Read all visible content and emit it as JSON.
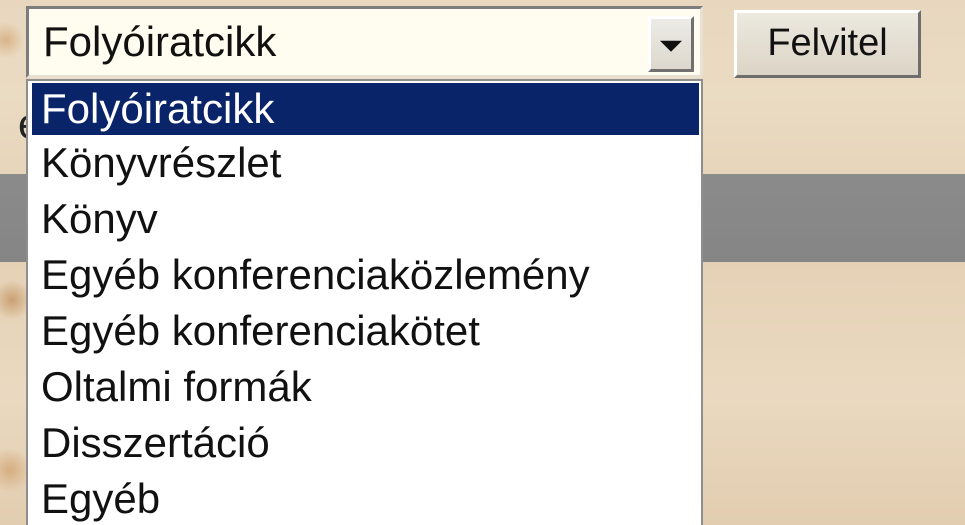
{
  "select": {
    "current_value": "Folyóiratcikk",
    "options": [
      {
        "label": "Folyóiratcikk",
        "selected": true
      },
      {
        "label": "Könyvrészlet",
        "selected": false
      },
      {
        "label": "Könyv",
        "selected": false
      },
      {
        "label": "Egyéb konferenciaközlemény",
        "selected": false
      },
      {
        "label": "Egyéb konferenciakötet",
        "selected": false
      },
      {
        "label": "Oltalmi formák",
        "selected": false
      },
      {
        "label": "Disszertáció",
        "selected": false
      },
      {
        "label": "Egyéb",
        "selected": false
      }
    ]
  },
  "submit_button": {
    "label": "Felvitel"
  },
  "background_text": {
    "partial_letter": "é"
  },
  "icons": {
    "dropdown_arrow": "chevron-down-icon"
  },
  "colors": {
    "selection_background": "#0a246a",
    "selection_text": "#ffffff",
    "background_band": "#888888",
    "select_background": "#fffdf0"
  }
}
